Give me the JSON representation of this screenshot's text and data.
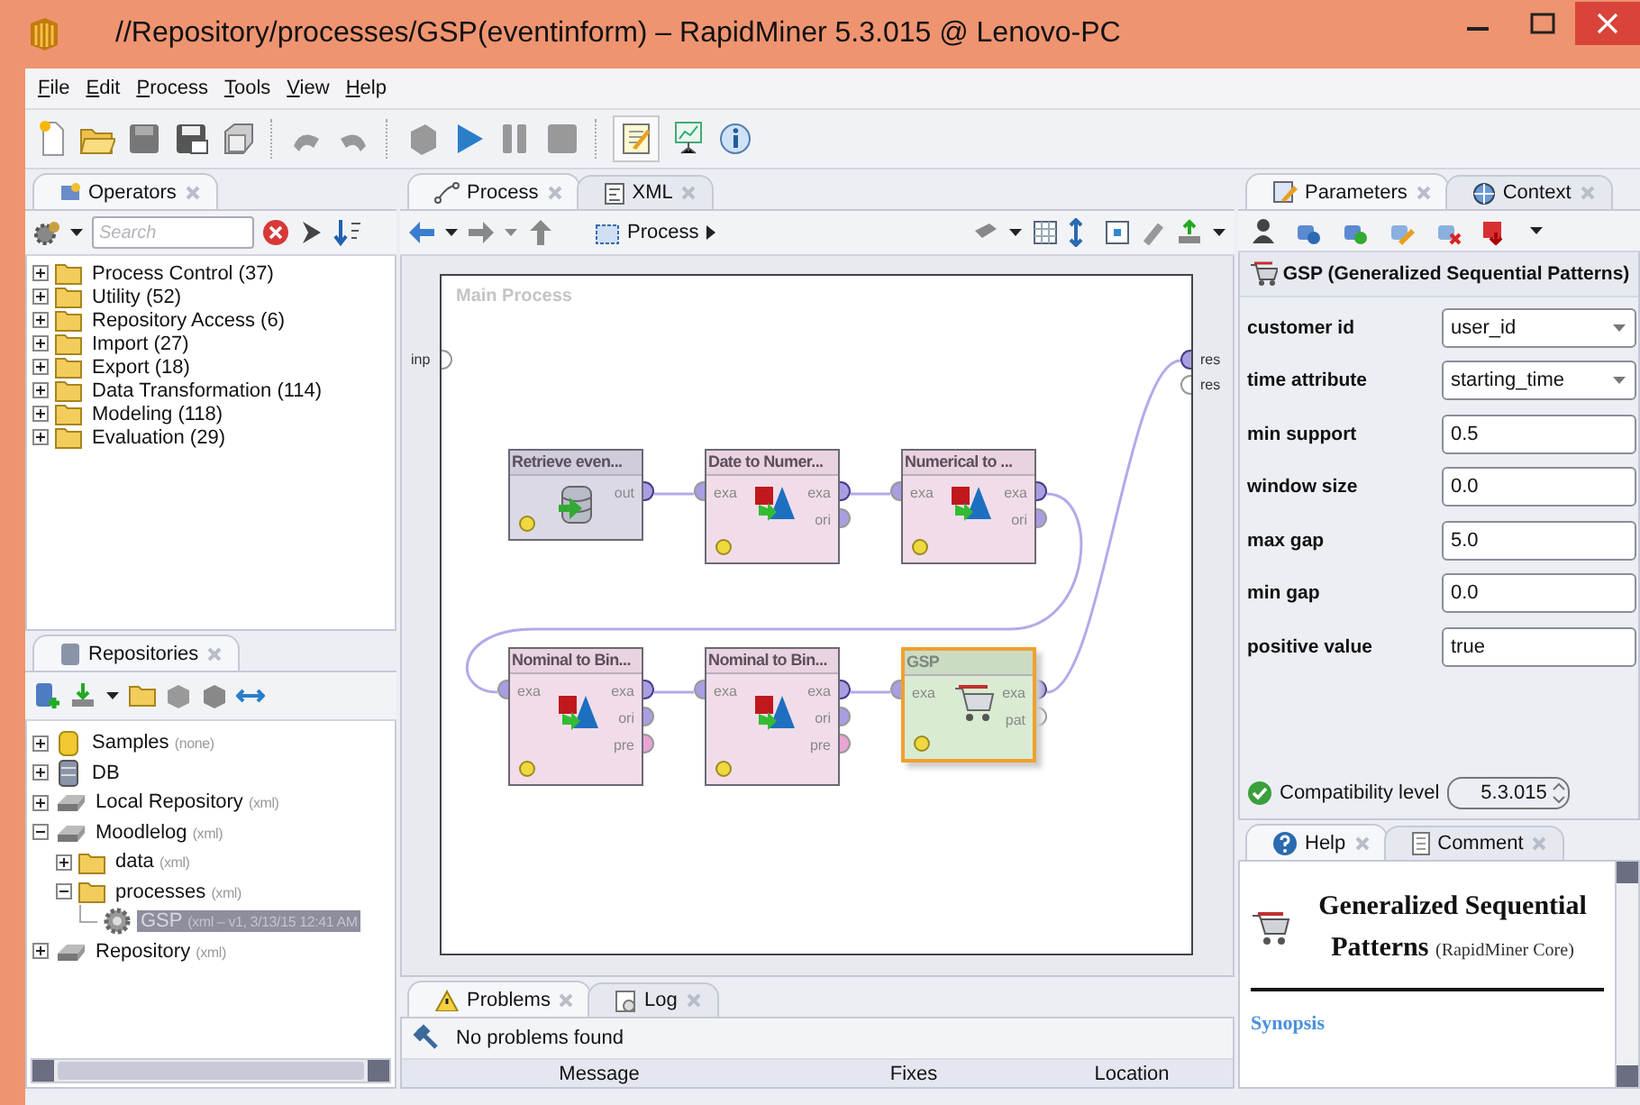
{
  "window": {
    "title": "//Repository/processes/GSP(eventinform) – RapidMiner 5.3.015 @ Lenovo-PC"
  },
  "menu": [
    "File",
    "Edit",
    "Process",
    "Tools",
    "View",
    "Help"
  ],
  "operators_panel": {
    "tabs": [
      {
        "label": "Operators",
        "selected": true
      }
    ],
    "search": {
      "placeholder": "Search"
    },
    "tree": [
      {
        "label": "Process Control (37)",
        "expanded": false
      },
      {
        "label": "Utility (52)",
        "expanded": false
      },
      {
        "label": "Repository Access (6)",
        "expanded": false
      },
      {
        "label": "Import (27)",
        "expanded": false
      },
      {
        "label": "Export (18)",
        "expanded": false
      },
      {
        "label": "Data Transformation (114)",
        "expanded": false
      },
      {
        "label": "Modeling (118)",
        "expanded": false
      },
      {
        "label": "Evaluation (29)",
        "expanded": false
      }
    ]
  },
  "repositories_panel": {
    "tabs": [
      {
        "label": "Repositories",
        "selected": true
      }
    ],
    "tree": [
      {
        "kind": "samples",
        "label": "Samples",
        "note": "(none)",
        "expanded": false,
        "selected": false
      },
      {
        "kind": "database",
        "label": "DB",
        "expanded": false,
        "selected": false
      },
      {
        "kind": "repository",
        "label": "Local Repository",
        "note": "(xml)",
        "expanded": false,
        "selected": false
      },
      {
        "kind": "repository",
        "label": "Moodlelog",
        "note": "(xml)",
        "expanded": true,
        "selected": false,
        "children": [
          {
            "kind": "folder",
            "label": "data",
            "note": "(xml)",
            "expanded": false,
            "selected": false
          },
          {
            "kind": "folder",
            "label": "processes",
            "note": "(xml)",
            "expanded": true,
            "selected": false,
            "children": [
              {
                "kind": "process",
                "label": "GSP",
                "note": "(xml  –  v1, 3/13/15 12:41 AM",
                "selected": true
              }
            ]
          }
        ]
      },
      {
        "kind": "repository",
        "label": "Repository",
        "note": "(xml)",
        "expanded": false,
        "selected": false
      }
    ]
  },
  "process_editor": {
    "tabs": [
      {
        "label": "Process",
        "selected": true
      },
      {
        "label": "XML",
        "selected": false
      }
    ],
    "breadcrumb": "Process",
    "canvas": {
      "title": "Main Process",
      "inputs": [
        {
          "label": "inp",
          "color": "#ffffff"
        }
      ],
      "outputs": [
        {
          "label": "res",
          "color": "#a99ee0",
          "connected": true
        },
        {
          "label": "res",
          "color": "#ffffff",
          "connected": false
        }
      ],
      "operator_rows": [
        {
          "operators": [
            {
              "name": "Retrieve even...",
              "kind": "retrieve",
              "selected": false,
              "outputs": [
                {
                  "label": "out",
                  "color": "#a99ee0",
                  "connected": true
                }
              ]
            },
            {
              "name": "Date to Numer...",
              "kind": "convert",
              "selected": false,
              "inputs": [
                {
                  "label": "exa",
                  "color": "#a99ee0"
                }
              ],
              "outputs": [
                {
                  "label": "exa",
                  "color": "#a99ee0",
                  "connected": true
                },
                {
                  "label": "ori",
                  "color": "#a99ee0",
                  "connected": false
                }
              ]
            },
            {
              "name": "Numerical to ...",
              "kind": "convert",
              "selected": false,
              "inputs": [
                {
                  "label": "exa",
                  "color": "#a99ee0"
                }
              ],
              "outputs": [
                {
                  "label": "exa",
                  "color": "#a99ee0",
                  "connected": true
                },
                {
                  "label": "ori",
                  "color": "#a99ee0",
                  "connected": false
                }
              ]
            }
          ]
        },
        {
          "operators": [
            {
              "name": "Nominal to Bin...",
              "kind": "convert",
              "selected": false,
              "inputs": [
                {
                  "label": "exa",
                  "color": "#a99ee0"
                }
              ],
              "outputs": [
                {
                  "label": "exa",
                  "color": "#a99ee0",
                  "connected": true
                },
                {
                  "label": "ori",
                  "color": "#a99ee0",
                  "connected": false
                },
                {
                  "label": "pre",
                  "color": "#e8a4d4",
                  "connected": false
                }
              ]
            },
            {
              "name": "Nominal to Bin...",
              "kind": "convert",
              "selected": false,
              "inputs": [
                {
                  "label": "exa",
                  "color": "#a99ee0"
                }
              ],
              "outputs": [
                {
                  "label": "exa",
                  "color": "#a99ee0",
                  "connected": true
                },
                {
                  "label": "ori",
                  "color": "#a99ee0",
                  "connected": false
                },
                {
                  "label": "pre",
                  "color": "#e8a4d4",
                  "connected": false
                }
              ]
            },
            {
              "name": "GSP",
              "kind": "gsp",
              "selected": true,
              "inputs": [
                {
                  "label": "exa",
                  "color": "#a99ee0"
                }
              ],
              "outputs": [
                {
                  "label": "exa",
                  "color": "#a99ee0",
                  "connected": true
                },
                {
                  "label": "pat",
                  "color": "#ffffff",
                  "connected": false
                }
              ]
            }
          ]
        }
      ]
    }
  },
  "problems_panel": {
    "tabs": [
      {
        "label": "Problems",
        "selected": true
      },
      {
        "label": "Log",
        "selected": false
      }
    ],
    "message": "No problems found",
    "columns": [
      "Message",
      "Fixes",
      "Location"
    ]
  },
  "parameters_panel": {
    "tabs": [
      {
        "label": "Parameters",
        "selected": true
      },
      {
        "label": "Context",
        "selected": false
      }
    ],
    "operator_title": "GSP (Generalized Sequential Patterns)",
    "parameters": [
      {
        "label": "customer id",
        "value": "user_id",
        "kind": "select"
      },
      {
        "label": "time attribute",
        "value": "starting_time",
        "kind": "select"
      },
      {
        "label": "min support",
        "value": "0.5",
        "kind": "text"
      },
      {
        "label": "window size",
        "value": "0.0",
        "kind": "text"
      },
      {
        "label": "max gap",
        "value": "5.0",
        "kind": "text"
      },
      {
        "label": "min gap",
        "value": "0.0",
        "kind": "text"
      },
      {
        "label": "positive value",
        "value": "true",
        "kind": "text"
      }
    ],
    "compatibility": {
      "label": "Compatibility level",
      "value": "5.3.015"
    }
  },
  "help_panel": {
    "tabs": [
      {
        "label": "Help",
        "selected": true
      },
      {
        "label": "Comment",
        "selected": false
      }
    ],
    "title": "Generalized Sequential Patterns",
    "source": "(RapidMiner Core)",
    "link": "Synopsis"
  }
}
